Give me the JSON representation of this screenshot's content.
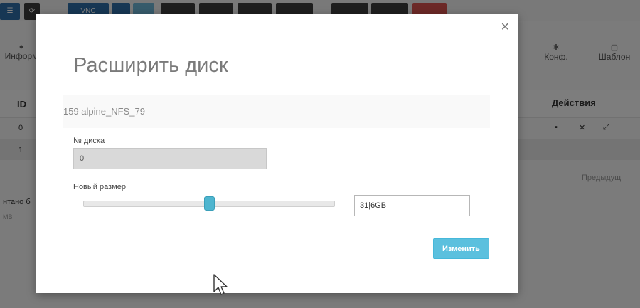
{
  "background": {
    "toolbar": {
      "vnc_label": "VNC"
    },
    "nav": {
      "info_label": "Информ",
      "config_label": "Конф.",
      "template_label": "Шаблон"
    },
    "table": {
      "id_header": "ID",
      "actions_header": "Действия",
      "row_ids": [
        "0",
        "1"
      ]
    },
    "pagination": {
      "prev_label": "Предыдущ"
    },
    "chart_fragment": {
      "label": "нтано б"
    }
  },
  "modal": {
    "title": "Расширить диск",
    "vm_name": "159 alpine_NFS_79",
    "disk_number_label": "№ диска",
    "disk_number_value": "0",
    "new_size_label": "Новый размер",
    "new_size_value": "31|6GB",
    "size_slider_fraction": 0.5,
    "apply_button": "Изменить",
    "close_symbol": "×"
  },
  "colors": {
    "accent": "#5bc0de",
    "slider_thumb": "#4eb5cf",
    "toolbar_primary": "#2f6fa8",
    "toolbar_dark": "#3c3c3c",
    "toolbar_danger": "#d9534f"
  }
}
